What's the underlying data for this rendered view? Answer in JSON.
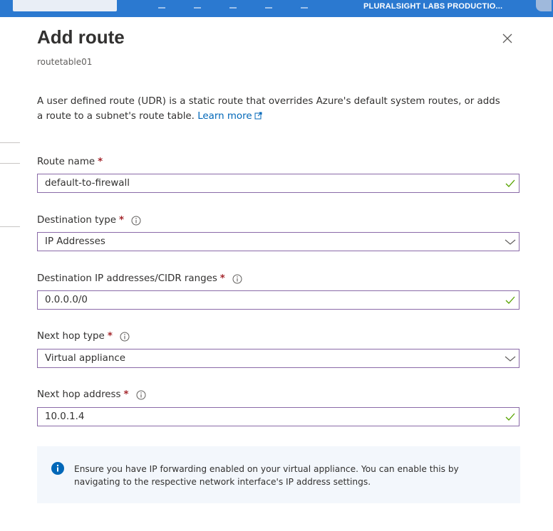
{
  "topbar": {
    "tenant": "PLURALSIGHT LABS PRODUCTIO..."
  },
  "panel": {
    "title": "Add route",
    "subtitle": "routetable01",
    "intro_text": "A user defined route (UDR) is a static route that overrides Azure's default system routes, or adds a route to a subnet's route table.",
    "learn_more": "Learn more"
  },
  "form": {
    "route_name": {
      "label": "Route name",
      "required_mark": "*",
      "value": "default-to-firewall"
    },
    "destination_type": {
      "label": "Destination type",
      "required_mark": "*",
      "value": "IP Addresses"
    },
    "destination_ip": {
      "label": "Destination IP addresses/CIDR ranges",
      "required_mark": "*",
      "value": "0.0.0.0/0"
    },
    "next_hop_type": {
      "label": "Next hop type",
      "required_mark": "*",
      "value": "Virtual appliance"
    },
    "next_hop_address": {
      "label": "Next hop address",
      "required_mark": "*",
      "value": "10.0.1.4"
    }
  },
  "notice": {
    "text": "Ensure you have IP forwarding enabled on your virtual appliance. You can enable this by navigating to the respective network interface's IP address settings."
  },
  "icons": {
    "valid": "checkmark-icon",
    "dropdown": "chevron-down-icon",
    "info": "info-icon",
    "close": "close-icon",
    "external": "external-link-icon"
  },
  "colors": {
    "accent": "#0067b8",
    "required": "#a4262c",
    "valid": "#57a300",
    "field_border": "#8a6aa8",
    "topbar": "#2b79d0",
    "notice_bg": "#f3f7fc"
  }
}
